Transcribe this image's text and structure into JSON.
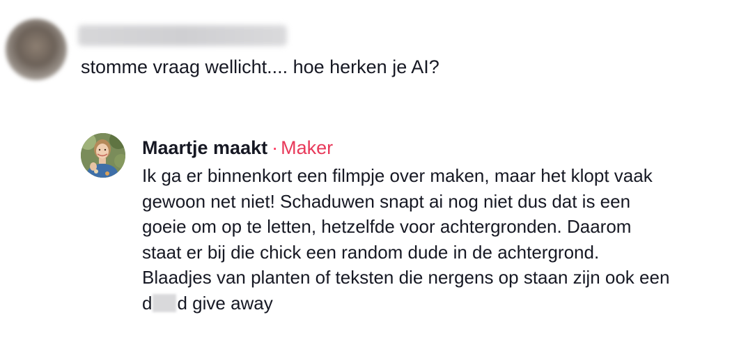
{
  "comment": {
    "text": "stomme vraag wellicht.... hoe herken je AI?"
  },
  "reply": {
    "author": "Maartje maakt",
    "separator": "·",
    "badge": "Maker",
    "lines": [
      "Ik ga er binnenkort een filmpje over maken, maar het klopt vaak",
      "gewoon net niet! Schaduwen snapt ai nog niet dus dat is een",
      "goeie om op te letten, hetzelfde voor achtergronden. Daarom",
      "staat er bij die chick een random dude in de achtergrond.",
      "Blaadjes van planten of teksten die nergens op staan zijn ook een"
    ],
    "last_line_start": "d",
    "last_line_end": "d give away"
  },
  "colors": {
    "text": "#161823",
    "maker_badge": "#e8395a"
  }
}
